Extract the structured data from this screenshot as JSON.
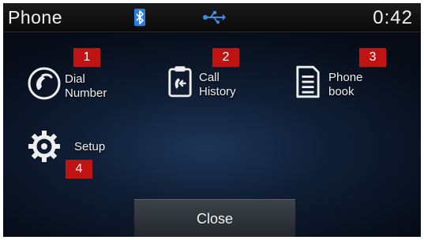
{
  "status_bar": {
    "title": "Phone",
    "time": "0:42",
    "icons": [
      "bluetooth-icon",
      "usb-icon"
    ]
  },
  "menu": {
    "dial": {
      "line1": "Dial",
      "line2": "Number",
      "badge": "1",
      "icon": "phone-handset-icon"
    },
    "history": {
      "line1": "Call",
      "line2": "History",
      "badge": "2",
      "icon": "call-history-icon"
    },
    "phonebook": {
      "line1": "Phone",
      "line2": "book",
      "badge": "3",
      "icon": "phonebook-icon"
    },
    "setup": {
      "label": "Setup",
      "badge": "4",
      "icon": "gear-icon"
    }
  },
  "footer": {
    "close_label": "Close"
  },
  "colors": {
    "badge_red": "#c01414",
    "bluetooth_blue": "#2a7de1",
    "screen_bg": "#0f1d33"
  }
}
